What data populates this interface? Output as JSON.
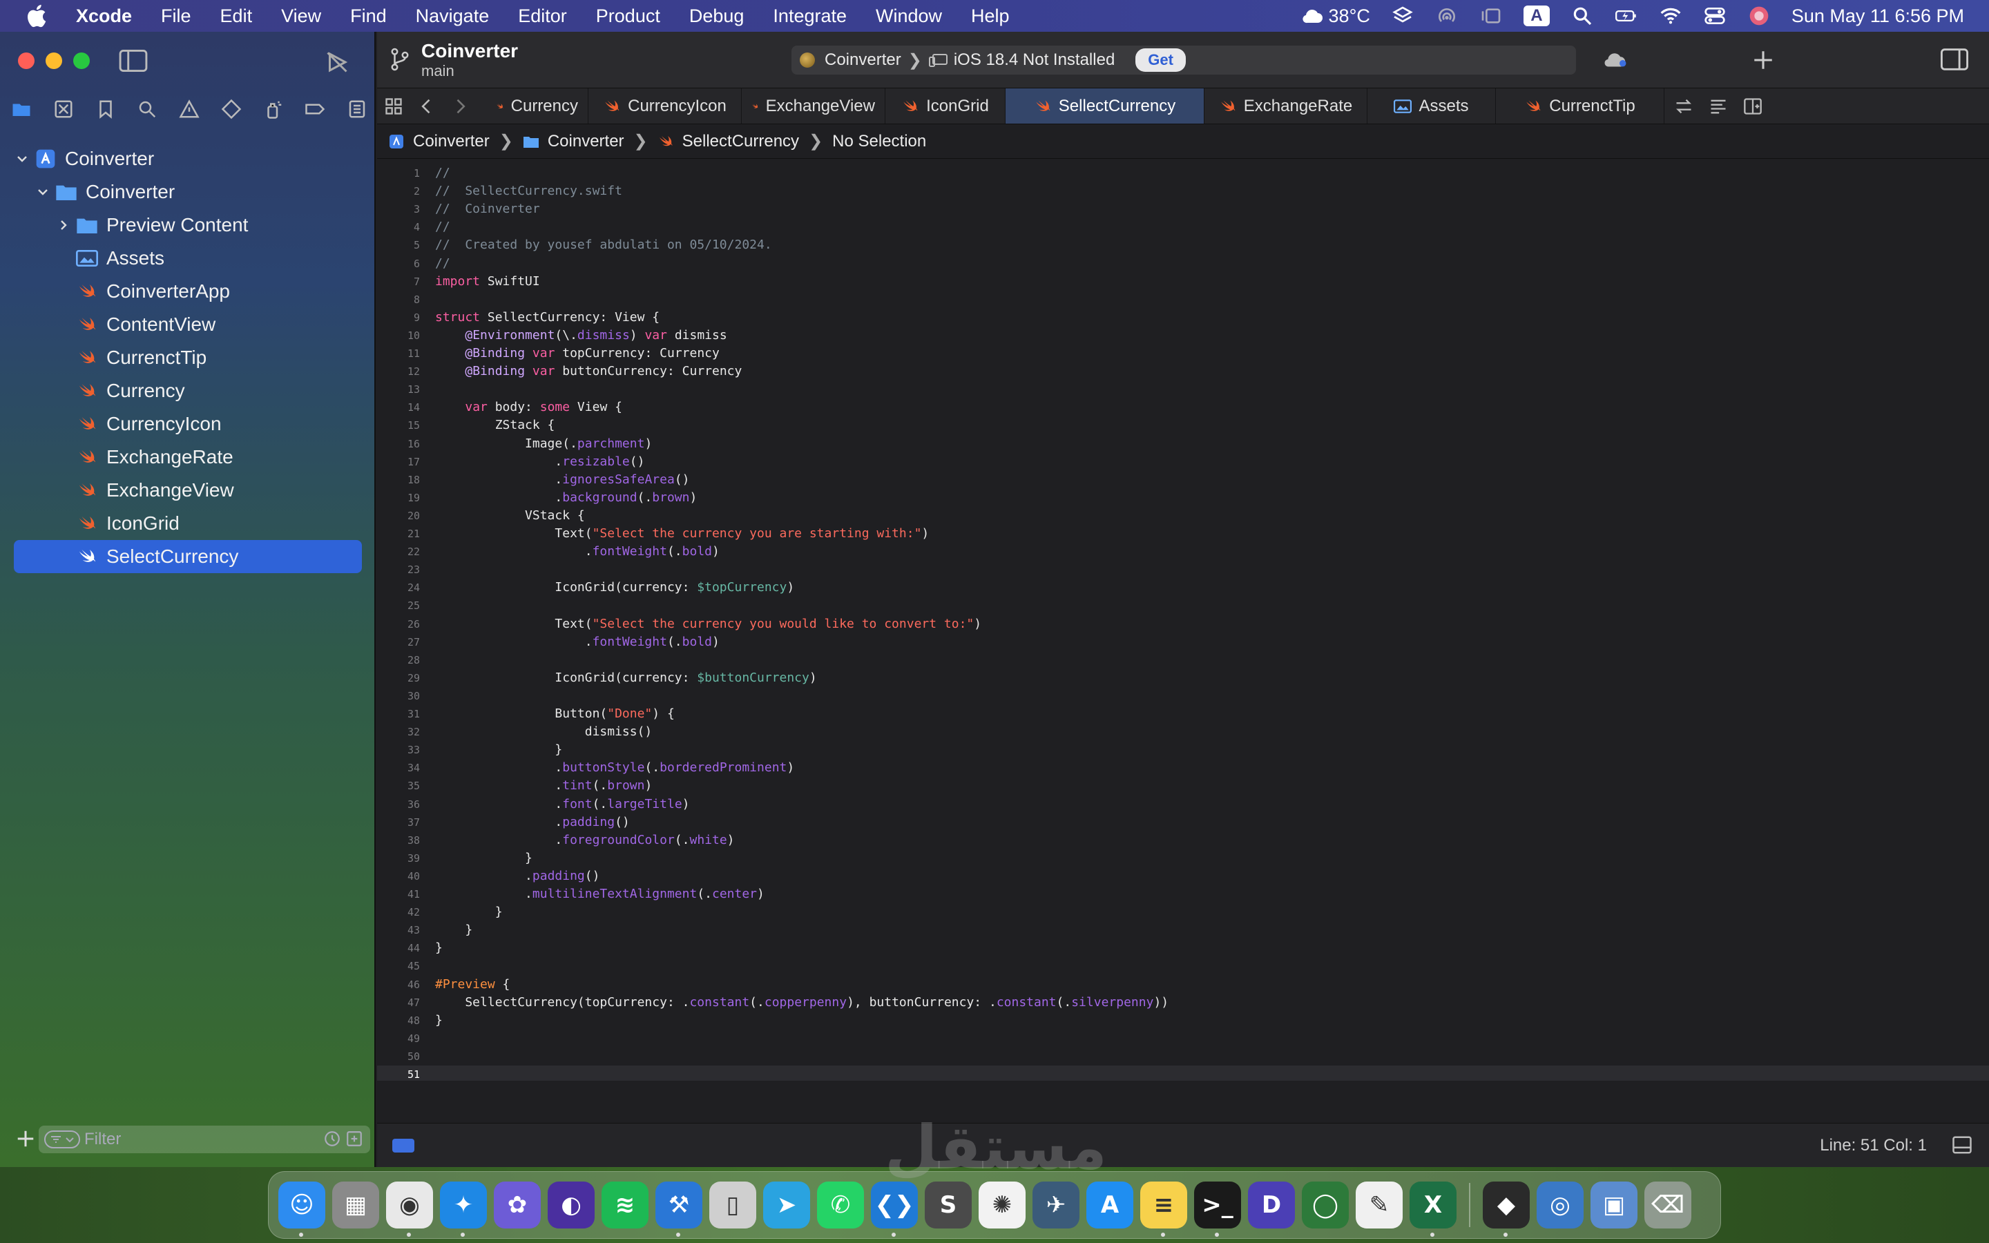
{
  "menubar": {
    "app_name": "Xcode",
    "items": [
      "File",
      "Edit",
      "View",
      "Find",
      "Navigate",
      "Editor",
      "Product",
      "Debug",
      "Integrate",
      "Window",
      "Help"
    ],
    "weather": "38°C",
    "datetime": "Sun May 11  6:56 PM",
    "input_source": "A"
  },
  "sidebar": {
    "tree": [
      {
        "label": "Coinverter",
        "kind": "project"
      },
      {
        "label": "Coinverter",
        "kind": "folder"
      },
      {
        "label": "Preview Content",
        "kind": "folder-collapsed"
      },
      {
        "label": "Assets",
        "kind": "assets"
      },
      {
        "label": "CoinverterApp",
        "kind": "swift"
      },
      {
        "label": "ContentView",
        "kind": "swift"
      },
      {
        "label": "CurrenctTip",
        "kind": "swift"
      },
      {
        "label": "Currency",
        "kind": "swift"
      },
      {
        "label": "CurrencyIcon",
        "kind": "swift"
      },
      {
        "label": "ExchangeRate",
        "kind": "swift"
      },
      {
        "label": "ExchangeView",
        "kind": "swift"
      },
      {
        "label": "IconGrid",
        "kind": "swift"
      },
      {
        "label": "SelectCurrency",
        "kind": "swift",
        "selected": true
      }
    ],
    "filter_placeholder": "Filter"
  },
  "toolbar": {
    "project": "Coinverter",
    "branch": "main",
    "scheme": "Coinverter",
    "destination": "iOS 18.4 Not Installed",
    "get_label": "Get"
  },
  "tabs": [
    {
      "label": "Currency",
      "active": false
    },
    {
      "label": "CurrencyIcon",
      "active": false
    },
    {
      "label": "ExchangeView",
      "active": false
    },
    {
      "label": "IconGrid",
      "active": false
    },
    {
      "label": "SellectCurrency",
      "active": true
    },
    {
      "label": "ExchangeRate",
      "active": false
    },
    {
      "label": "Assets",
      "active": false
    },
    {
      "label": "CurrenctTip",
      "active": false
    }
  ],
  "jumpbar": {
    "project": "Coinverter",
    "folder": "Coinverter",
    "file": "SellectCurrency",
    "selection": "No Selection"
  },
  "editor": {
    "current_line": 51,
    "lines": [
      "//",
      "//  SellectCurrency.swift",
      "//  Coinverter",
      "//",
      "//  Created by yousef abdulati on 05/10/2024.",
      "//",
      "import SwiftUI",
      "",
      "struct SellectCurrency: View {",
      "    @Environment(\\.dismiss) var dismiss",
      "    @Binding var topCurrency: Currency",
      "    @Binding var buttonCurrency: Currency",
      "",
      "    var body: some View {",
      "        ZStack {",
      "            Image(.parchment)",
      "                .resizable()",
      "                .ignoresSafeArea()",
      "                .background(.brown)",
      "            VStack {",
      "                Text(\"Select the currency you are starting with:\")",
      "                    .fontWeight(.bold)",
      "",
      "                IconGrid(currency: $topCurrency)",
      "",
      "                Text(\"Select the currency you would like to convert to:\")",
      "                    .fontWeight(.bold)",
      "",
      "                IconGrid(currency: $buttonCurrency)",
      "",
      "                Button(\"Done\") {",
      "                    dismiss()",
      "                }",
      "                .buttonStyle(.borderedProminent)",
      "                .tint(.brown)",
      "                .font(.largeTitle)",
      "                .padding()",
      "                .foregroundColor(.white)",
      "            }",
      "            .padding()",
      "            .multilineTextAlignment(.center)",
      "        }",
      "    }",
      "}",
      "",
      "#Preview {",
      "    SellectCurrency(topCurrency: .constant(.copperpenny), buttonCurrency: .constant(.silverpenny))",
      "}",
      "",
      "",
      ""
    ]
  },
  "statusbar": {
    "cursor": "Line: 51  Col: 1"
  },
  "watermark": "مستقل",
  "dock": {
    "apps": [
      {
        "name": "finder-icon",
        "color": "#2d8cf0",
        "glyph": "☺",
        "running": true
      },
      {
        "name": "launchpad-icon",
        "color": "#8a8a8a",
        "glyph": "▦",
        "running": false
      },
      {
        "name": "chrome-icon",
        "color": "#e8e8e8",
        "glyph": "◉",
        "running": true
      },
      {
        "name": "safari-icon",
        "color": "#1e88e5",
        "glyph": "✦",
        "running": true
      },
      {
        "name": "creative-app-icon",
        "color": "#6d5cd6",
        "glyph": "✿",
        "running": false
      },
      {
        "name": "firefox-icon",
        "color": "#4a2f9f",
        "glyph": "◐",
        "running": false
      },
      {
        "name": "spotify-icon",
        "color": "#1db954",
        "glyph": "≋",
        "running": false
      },
      {
        "name": "xcode-icon",
        "color": "#2a77d6",
        "glyph": "⚒",
        "running": true
      },
      {
        "name": "configurator-icon",
        "color": "#cfcfcf",
        "glyph": "▯",
        "running": false
      },
      {
        "name": "telegram-icon",
        "color": "#2aa3e0",
        "glyph": "➤",
        "running": false
      },
      {
        "name": "whatsapp-icon",
        "color": "#25d366",
        "glyph": "✆",
        "running": false
      },
      {
        "name": "vscode-icon",
        "color": "#1f7ad6",
        "glyph": "❮❯",
        "running": true
      },
      {
        "name": "sublime-icon",
        "color": "#4a4a4a",
        "glyph": "S",
        "running": false
      },
      {
        "name": "chatgpt-icon",
        "color": "#f2f2f2",
        "glyph": "✺",
        "running": false
      },
      {
        "name": "instruments-icon",
        "color": "#3b5b7a",
        "glyph": "✈",
        "running": false
      },
      {
        "name": "appstore-icon",
        "color": "#1f8ef1",
        "glyph": "A",
        "running": false
      },
      {
        "name": "notes-icon",
        "color": "#f7d14b",
        "glyph": "≡",
        "running": true
      },
      {
        "name": "terminal-icon",
        "color": "#1a1a1a",
        "glyph": ">_",
        "running": true
      },
      {
        "name": "dash-icon",
        "color": "#4b3fb5",
        "glyph": "D",
        "running": false
      },
      {
        "name": "lasso-icon",
        "color": "#2d7a3a",
        "glyph": "◯",
        "running": false
      },
      {
        "name": "textedit-icon",
        "color": "#f0f0f0",
        "glyph": "✎",
        "running": false
      },
      {
        "name": "excel-icon",
        "color": "#1d7044",
        "glyph": "X",
        "running": true
      }
    ],
    "extras": [
      {
        "name": "cube-app-icon",
        "color": "#2a2a2a",
        "glyph": "◆",
        "running": true
      },
      {
        "name": "preview-icon",
        "color": "#3a79c6",
        "glyph": "◎",
        "running": false
      },
      {
        "name": "image-viewer-icon",
        "color": "#5b8ccf",
        "glyph": "▣",
        "running": false
      },
      {
        "name": "trash-icon",
        "color": "#8f9a8f",
        "glyph": "⌫",
        "running": false
      }
    ]
  }
}
